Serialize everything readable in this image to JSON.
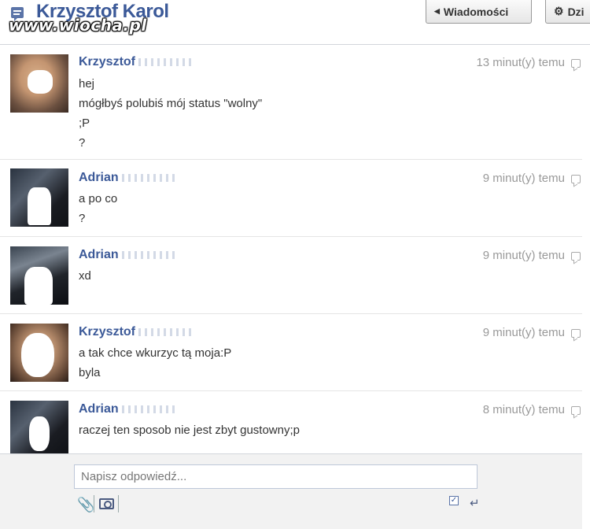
{
  "header": {
    "title": "Krzysztof Karol",
    "watermark": "www.wiocha.pl",
    "messages_button": "Wiadomości",
    "actions_button": "Dzi"
  },
  "messages": [
    {
      "author": "Krzysztof",
      "time": "13 minut(y) temu",
      "lines": [
        "hej",
        "mógłbyś polubiś mój status \"wolny\"",
        ";P",
        "?"
      ]
    },
    {
      "author": "Adrian",
      "time": "9 minut(y) temu",
      "lines": [
        "a po co",
        "?"
      ]
    },
    {
      "author": "Adrian",
      "time": "9 minut(y) temu",
      "lines": [
        "xd"
      ]
    },
    {
      "author": "Krzysztof",
      "time": "9 minut(y) temu",
      "lines": [
        "a tak chce wkurzyc tą moja:P",
        "byla"
      ]
    },
    {
      "author": "Adrian",
      "time": "8 minut(y) temu",
      "lines": [
        "raczej ten sposob nie jest zbyt gustowny;p"
      ]
    }
  ],
  "composer": {
    "placeholder": "Napisz odpowiedź...",
    "enter_checked": true
  },
  "icons": {
    "header": "message-icon",
    "attach": "paperclip-icon",
    "photo": "camera-icon",
    "reply": "reply-icon",
    "enter": "enter-icon"
  },
  "colors": {
    "brand": "#3b5998",
    "timestamp": "#999999"
  }
}
